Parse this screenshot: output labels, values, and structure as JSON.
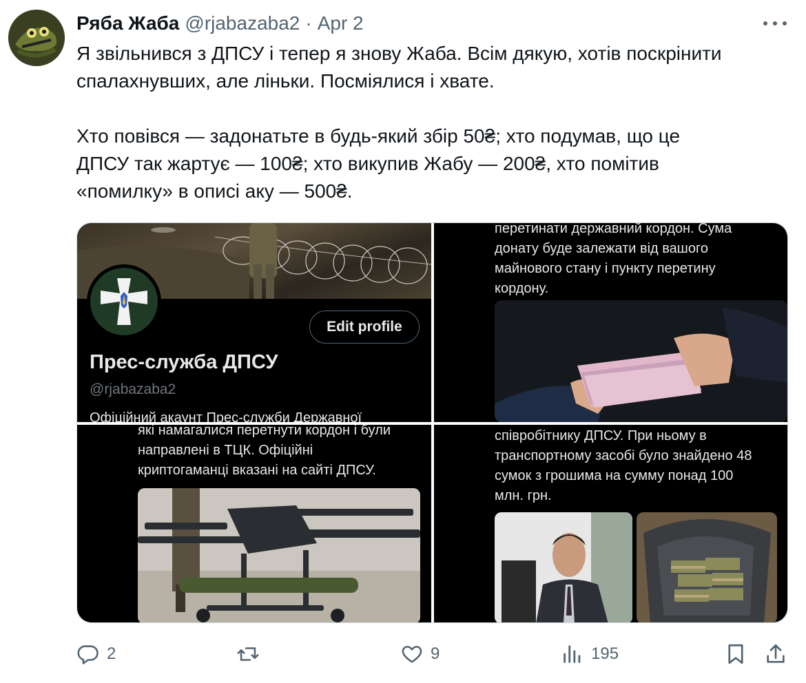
{
  "tweet": {
    "author_name": "Ряба Жаба",
    "author_handle": "@rjabazaba2",
    "separator": "·",
    "date": "Apr 2",
    "text_lines": [
      "Я звільнився з ДПСУ і тепер я знову Жаба. Всім дякую, хотів поскрінити",
      "спалахнувших, але ліньки. Посміялися і хвате.",
      "Хто повівся — задонатьте в будь-який збір 50₴; хто подумав, що це",
      "ДПСУ так жартує — 100₴; хто викупив Жабу — 200₴, хто помітив",
      "«помилку» в описі аку — 500₴."
    ]
  },
  "media": {
    "profile_card": {
      "edit_button": "Edit profile",
      "name": "Прес-служба ДПСУ",
      "handle": "@rjabazaba2",
      "bio": "Офіційний акаунт Прес-служби Державної"
    },
    "screenshot2_lines": [
      "перетинати державний кордон. Сума",
      "донату буде залежати від вашого",
      "майнового стану і пункту перетину",
      "кордону."
    ],
    "screenshot3_lines": [
      "які намагалися перетнути кордон і були",
      "направлені в ТЦК. Офіційні",
      "криптогаманці вказані на сайті ДПСУ."
    ],
    "screenshot4_lines": [
      "співробітнику ДПСУ. При ньому в",
      "транспортному засобі було знайдено 48",
      "сумок з грошима на сумму понад 100",
      "млн. грн."
    ]
  },
  "actions": {
    "replies": "2",
    "retweets": "",
    "likes": "9",
    "views": "195"
  },
  "icons": {
    "more": "more-horizontal-icon",
    "reply": "reply-icon",
    "retweet": "retweet-icon",
    "like": "heart-icon",
    "views": "views-chart-icon",
    "bookmark": "bookmark-icon",
    "share": "share-icon"
  },
  "colors": {
    "text": "#0f1419",
    "secondary": "#536471",
    "dark_bg": "#000000",
    "dark_text": "#e7e9ea"
  }
}
